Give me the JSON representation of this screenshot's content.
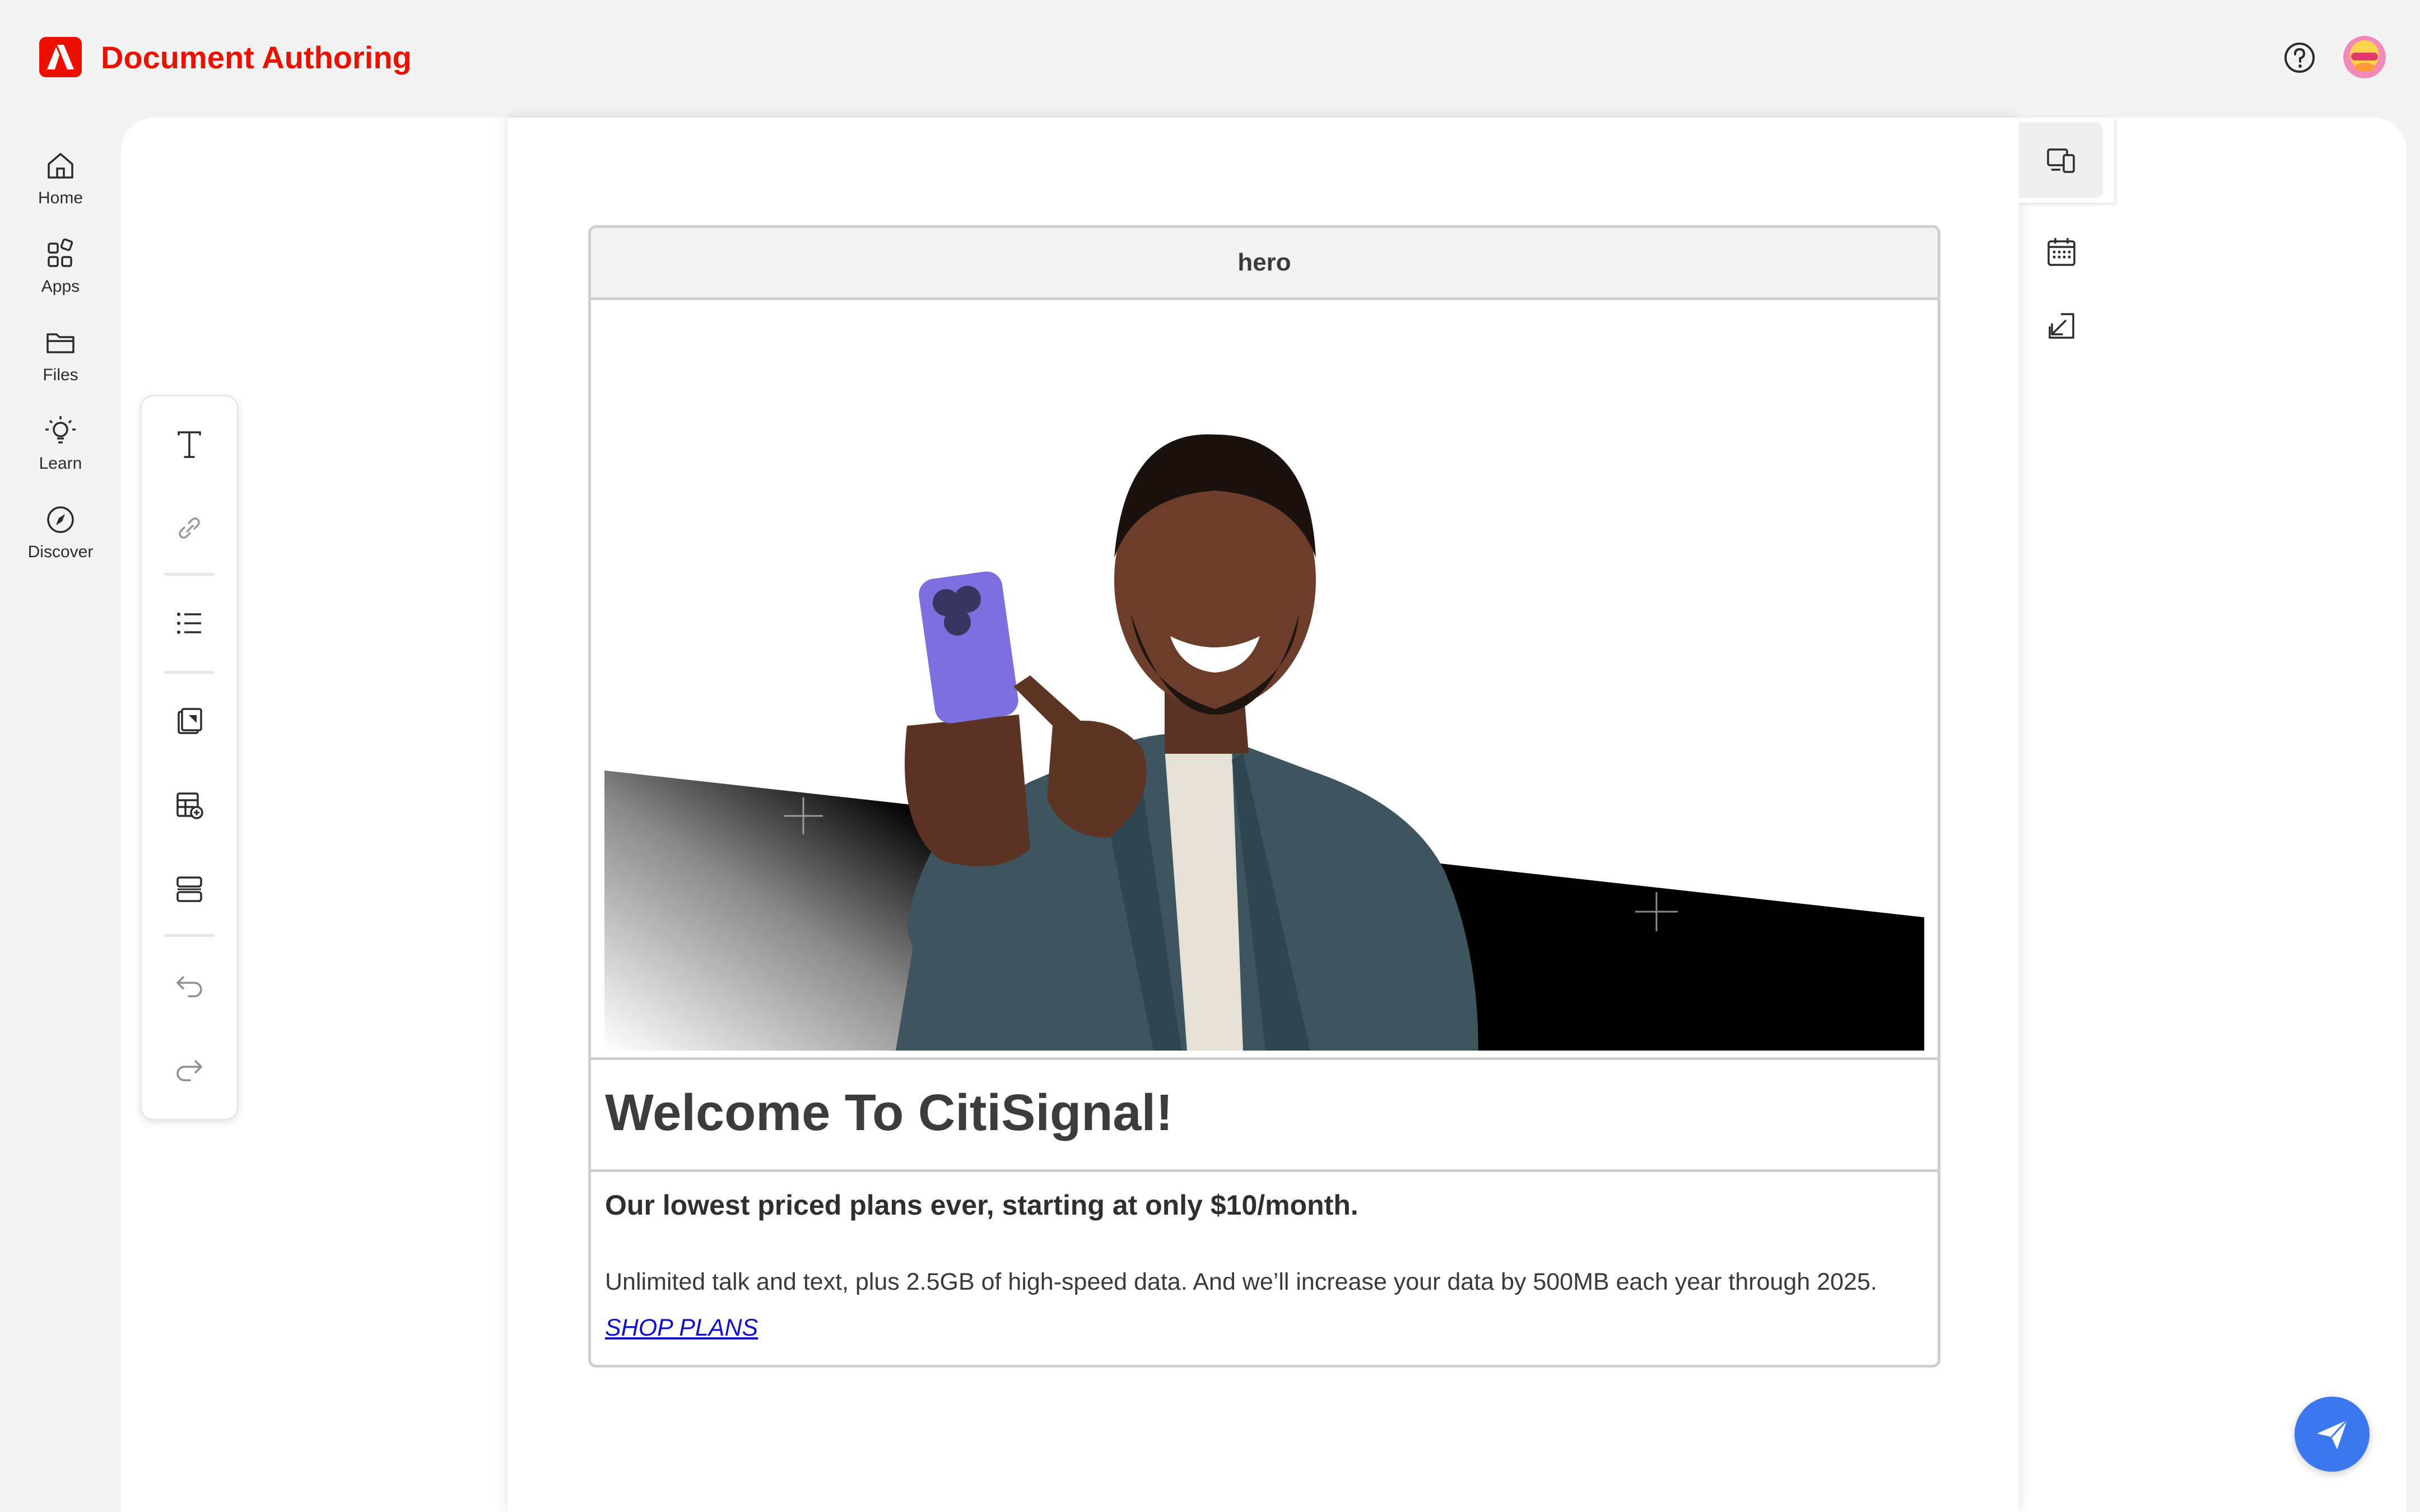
{
  "app": {
    "title": "Document Authoring"
  },
  "header": {
    "help_icon": "help-icon",
    "avatar": "user-avatar"
  },
  "sidebar": {
    "items": [
      {
        "label": "Home",
        "icon": "home-icon"
      },
      {
        "label": "Apps",
        "icon": "apps-icon"
      },
      {
        "label": "Files",
        "icon": "folder-icon"
      },
      {
        "label": "Learn",
        "icon": "lightbulb-icon"
      },
      {
        "label": "Discover",
        "icon": "compass-icon"
      }
    ]
  },
  "toolbar": {
    "items": [
      "text-icon",
      "link-icon",
      "list-icon",
      "image-icon",
      "table-add-icon",
      "section-icon",
      "undo-icon",
      "redo-icon"
    ]
  },
  "right_panel": {
    "items": [
      "preview-devices-icon",
      "calendar-icon",
      "open-icon"
    ]
  },
  "block": {
    "name": "hero",
    "title": "Welcome To CitiSignal!",
    "subtitle": "Our lowest priced plans ever, starting at only $10/month.",
    "description": "Unlimited talk and text, plus 2.5GB of high-speed data. And we’ll increase your data by 500MB each year through 2025.",
    "cta": "SHOP PLANS"
  },
  "colors": {
    "brand": "#eb1000",
    "fab": "#3b78f0",
    "link": "#1010c8"
  },
  "fab": {
    "icon": "send-icon"
  }
}
